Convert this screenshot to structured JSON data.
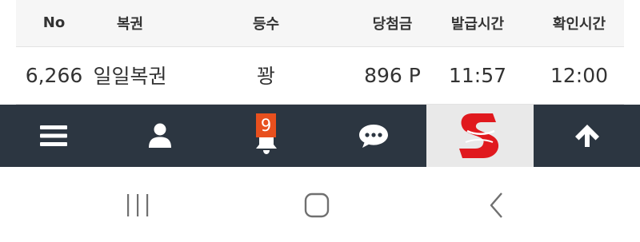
{
  "table": {
    "headers": [
      "No",
      "복권",
      "등수",
      "당첨금",
      "발급시간",
      "확인시간"
    ],
    "rows": [
      [
        "6,266",
        "일일복권",
        "꽝",
        "896 P",
        "11:57",
        "12:00"
      ]
    ]
  },
  "bottom_nav": {
    "items": [
      {
        "icon": "menu-icon"
      },
      {
        "icon": "user-icon"
      },
      {
        "icon": "bell-icon",
        "badge": "9"
      },
      {
        "icon": "chat-icon"
      },
      {
        "icon": "logo-s"
      },
      {
        "icon": "arrow-up-icon"
      }
    ]
  },
  "system_nav": {
    "items": [
      {
        "icon": "recent-apps-icon"
      },
      {
        "icon": "home-icon"
      },
      {
        "icon": "back-icon"
      }
    ]
  },
  "colors": {
    "nav_background": "#2c3641",
    "badge": "#e8501e",
    "logo_red": "#e0191e",
    "logo_panel": "#e9e9e9",
    "header_row": "#f6f6f6"
  }
}
